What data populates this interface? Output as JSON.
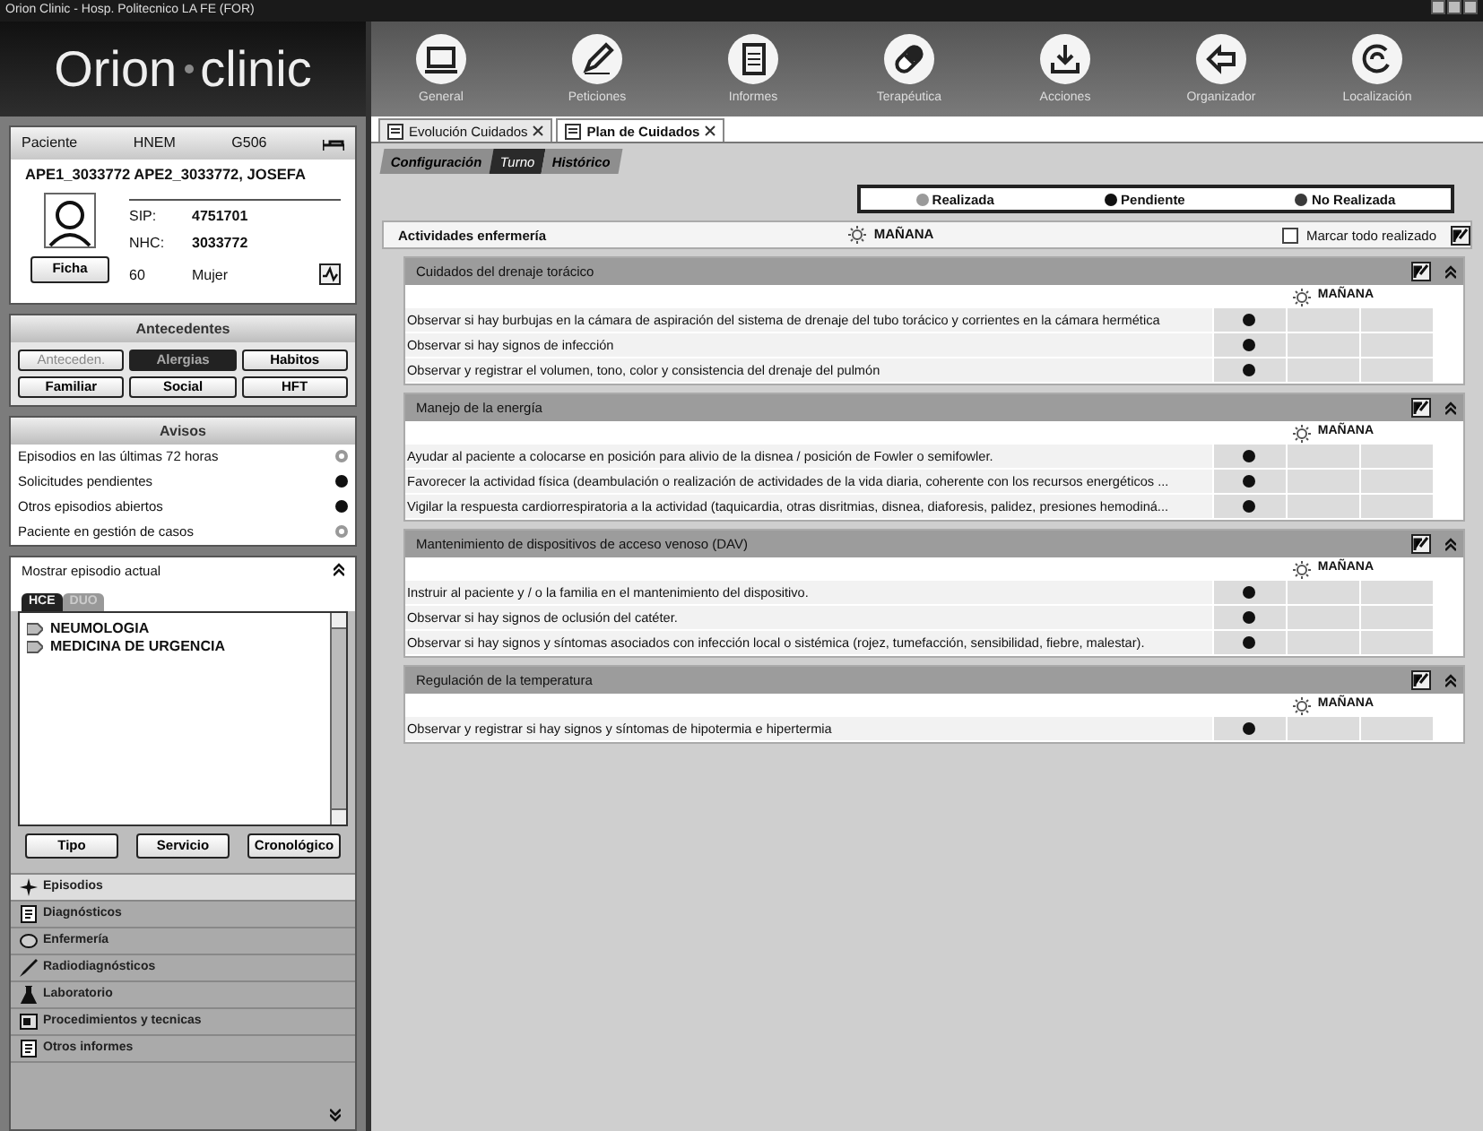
{
  "window": {
    "title": "Orion Clinic - Hosp. Politecnico LA FE (FOR)"
  },
  "logo": {
    "first": "Orion",
    "second": "clinic"
  },
  "toolbar": [
    {
      "label": "General"
    },
    {
      "label": "Peticiones"
    },
    {
      "label": "Informes"
    },
    {
      "label": "Terapéutica"
    },
    {
      "label": "Acciones"
    },
    {
      "label": "Organizador"
    },
    {
      "label": "Localización"
    }
  ],
  "patient": {
    "header": [
      "Paciente",
      "HNEM",
      "G506"
    ],
    "name": "APE1_3033772 APE2_3033772, JOSEFA",
    "sip_label": "SIP:",
    "sip": "4751701",
    "nhc_label": "NHC:",
    "nhc": "3033772",
    "age": "60",
    "sex": "Mujer",
    "button": "Ficha"
  },
  "antecedentes": {
    "title": "Antecedentes",
    "buttons": [
      {
        "label": "Anteceden.",
        "selected": false,
        "disabled": true
      },
      {
        "label": "Alergias",
        "selected": true,
        "disabled": false
      },
      {
        "label": "Habitos",
        "selected": false,
        "disabled": false
      },
      {
        "label": "Familiar",
        "selected": false,
        "disabled": false
      },
      {
        "label": "Social",
        "selected": false,
        "disabled": false
      },
      {
        "label": "HFT",
        "selected": false,
        "disabled": false
      }
    ]
  },
  "avisos": {
    "title": "Avisos",
    "items": [
      {
        "label": "Episodios en las últimas 72 horas",
        "on": false
      },
      {
        "label": "Solicitudes pendientes",
        "on": true
      },
      {
        "label": "Otros episodios abiertos",
        "on": true
      },
      {
        "label": "Paciente en gestión de casos",
        "on": false
      }
    ]
  },
  "episodes": {
    "show_current": "Mostrar episodio actual",
    "tabs": [
      {
        "label": "HCE",
        "selected": true
      },
      {
        "label": "DUO",
        "selected": false
      }
    ],
    "items": [
      "NEUMOLOGIA",
      "MEDICINA DE URGENCIA"
    ],
    "buttons": [
      "Tipo",
      "Servicio",
      "Cronológico"
    ]
  },
  "nav": [
    {
      "label": "Episodios",
      "selected": true
    },
    {
      "label": "Diagnósticos",
      "selected": false
    },
    {
      "label": "Enfermería",
      "selected": false
    },
    {
      "label": "Radiodiagnósticos",
      "selected": false
    },
    {
      "label": "Laboratorio",
      "selected": false
    },
    {
      "label": "Procedimientos y tecnicas",
      "selected": false
    },
    {
      "label": "Otros informes",
      "selected": false
    }
  ],
  "tabs": [
    {
      "label": "Evolución Cuidados",
      "selected": false
    },
    {
      "label": "Plan de Cuidados",
      "selected": true
    }
  ],
  "subtabs": [
    {
      "label": "Configuración",
      "selected": false
    },
    {
      "label": "Turno",
      "selected": true
    },
    {
      "label": "Histórico",
      "selected": false
    }
  ],
  "legend": [
    {
      "label": "Realizada",
      "kind": "realizada"
    },
    {
      "label": "Pendiente",
      "kind": "pendiente"
    },
    {
      "label": "No Realizada",
      "kind": "norealizada"
    }
  ],
  "activities_header": {
    "title": "Actividades enfermería",
    "shift": "MAÑANA",
    "mark_all": {
      "label": "Marcar todo realizado",
      "checked": false
    }
  },
  "sections": [
    {
      "title": "Cuidados del drenaje torácico",
      "shift": "MAÑANA",
      "activities": [
        {
          "text": "Observar si hay burbujas en la cámara de aspiración del sistema de drenaje del tubo torácico y corrientes en la cámara hermética",
          "kind": "pendiente"
        },
        {
          "text": "Observar si hay signos de infección",
          "kind": "pendiente"
        },
        {
          "text": "Observar y registrar el volumen, tono, color y consistencia del drenaje del pulmón",
          "kind": "pendiente"
        }
      ]
    },
    {
      "title": "Manejo de la energía",
      "shift": "MAÑANA",
      "activities": [
        {
          "text": "Ayudar al paciente a colocarse en posición para alivio de la disnea / posición de Fowler o semifowler.",
          "kind": "pendiente"
        },
        {
          "text": "Favorecer la actividad física (deambulación o realización de actividades de la vida diaria, coherente con los recursos energéticos ...",
          "kind": "pendiente"
        },
        {
          "text": "Vigilar la respuesta cardiorrespiratoria a la actividad (taquicardia, otras disritmias, disnea, diaforesis, palidez, presiones hemodiná...",
          "kind": "pendiente"
        }
      ]
    },
    {
      "title": "Mantenimiento de dispositivos de acceso venoso (DAV)",
      "shift": "MAÑANA",
      "activities": [
        {
          "text": "Instruir al paciente y / o la familia en el mantenimiento del dispositivo.",
          "kind": "pendiente"
        },
        {
          "text": "Observar si hay signos de oclusión del catéter.",
          "kind": "pendiente"
        },
        {
          "text": "Observar si hay signos y síntomas asociados con infección local o sistémica (rojez, tumefacción, sensibilidad, fiebre, malestar).",
          "kind": "pendiente"
        }
      ]
    },
    {
      "title": "Regulación de la temperatura",
      "shift": "MAÑANA",
      "activities": [
        {
          "text": "Observar y registrar si hay signos y síntomas de hipotermia e hipertermia",
          "kind": "pendiente"
        }
      ]
    }
  ]
}
